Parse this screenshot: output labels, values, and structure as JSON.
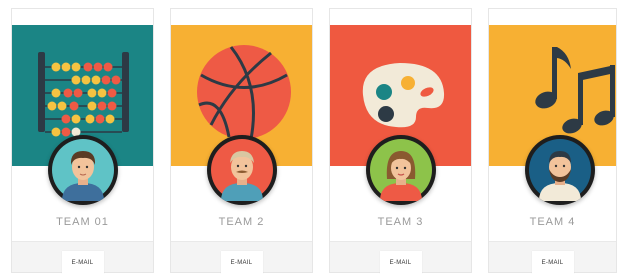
{
  "teams": [
    {
      "name": "TEAM 01",
      "email_label": "E-MAIL",
      "banner_color": "#1b8585",
      "banner_icon": "abacus-icon",
      "avatar_bg": "#5fc3c6"
    },
    {
      "name": "TEAM 2",
      "email_label": "E-MAIL",
      "banner_color": "#f7b033",
      "banner_icon": "basketball-icon",
      "avatar_bg": "#ee5a45"
    },
    {
      "name": "TEAM 3",
      "email_label": "E-MAIL",
      "banner_color": "#ef5940",
      "banner_icon": "palette-icon",
      "avatar_bg": "#8dc34a"
    },
    {
      "name": "TEAM 4",
      "email_label": "E-MAIL",
      "banner_color": "#f7b033",
      "banner_icon": "music-notes-icon",
      "avatar_bg": "#1a5f86"
    }
  ]
}
